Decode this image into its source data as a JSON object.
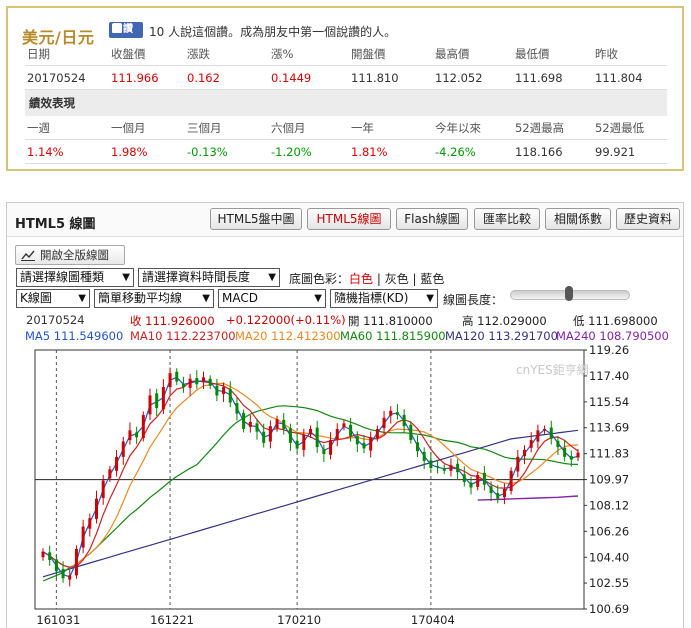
{
  "quote": {
    "title": "美元/日元",
    "like_label": "讚",
    "like_text": "10 人說這個讚。成為朋友中第一個說讚的人。",
    "headers1": [
      "日期",
      "收盤價",
      "漲跌",
      "漲%",
      "開盤價",
      "最高價",
      "最低價",
      "昨收"
    ],
    "values1": [
      "20170524",
      "111.966",
      "0.162",
      "0.1449",
      "111.810",
      "112.052",
      "111.698",
      "111.804"
    ],
    "section_title": "績效表現",
    "headers2": [
      "一週",
      "一個月",
      "三個月",
      "六個月",
      "一年",
      "今年以來",
      "52週最高",
      "52週最低"
    ],
    "values2": [
      "1.14%",
      "1.98%",
      "-0.13%",
      "-1.20%",
      "1.81%",
      "-4.26%",
      "118.166",
      "99.921"
    ]
  },
  "chart_panel": {
    "heading": "HTML5 線圖",
    "tabs": [
      "HTML5盤中圖",
      "HTML5線圖",
      "Flash線圖",
      "匯率比較",
      "相關係數",
      "歷史資料"
    ],
    "active_tab": "HTML5線圖",
    "expand_label": "開啟全版線圖",
    "selects": {
      "chart_type": "請選擇線圖種類",
      "period": "請選擇資料時間長度",
      "kline": "K線圖",
      "ma": "簡單移動平均線",
      "indicator": "MACD",
      "random": "隨機指標(KD)"
    },
    "bg_color_label": "底圖色彩：",
    "bg_options": [
      "白色",
      "灰色",
      "藍色"
    ],
    "line_length_label": "線圖長度：",
    "line_length_fraction": 0.55,
    "info": {
      "date": "20170524",
      "close": "收 111.926000",
      "change": "+0.122000(+0.11%)",
      "open": "開 111.810000",
      "high": "高 112.029000",
      "low": "低 111.698000",
      "ma5": "MA5 111.549600",
      "ma10": "MA10 112.223700",
      "ma20": "MA20 112.412300",
      "ma60": "MA60 111.815900",
      "ma120": "MA120 113.291700",
      "ma240": "MA240 108.790500"
    },
    "watermark": "cnYES鉅亨網",
    "colors": {
      "up": "#cc0000",
      "down": "#008800",
      "ma5": "#2255cc",
      "ma10": "#cc2222",
      "ma20": "#ee8822",
      "ma60": "#118811",
      "ma120": "#333388",
      "ma240": "#8822aa"
    }
  },
  "chart_data": {
    "type": "candlestick",
    "y_ticks": [
      "119.26",
      "117.40",
      "115.54",
      "113.69",
      "111.83",
      "109.97",
      "108.12",
      "106.26",
      "104.40",
      "102.55",
      "100.69"
    ],
    "ylim": [
      100.69,
      119.26
    ],
    "x_ticks": [
      "161031",
      "161221",
      "170210",
      "170404"
    ],
    "reference_line": 109.97,
    "close_path": [
      104.8,
      104.2,
      103.4,
      102.9,
      103.1,
      105.0,
      106.6,
      107.2,
      108.6,
      109.9,
      110.7,
      111.6,
      112.7,
      113.5,
      113.0,
      114.6,
      116.0,
      115.1,
      116.6,
      117.6,
      117.0,
      116.6,
      117.2,
      116.8,
      117.3,
      116.7,
      116.0,
      116.6,
      115.5,
      114.7,
      113.6,
      114.1,
      113.4,
      112.6,
      113.8,
      114.3,
      113.6,
      112.6,
      112.2,
      113.2,
      113.6,
      112.3,
      111.8,
      112.8,
      113.6,
      114.0,
      113.1,
      112.5,
      112.2,
      113.0,
      113.6,
      114.4,
      114.9,
      114.6,
      113.8,
      112.8,
      112.0,
      111.3,
      110.8,
      110.9,
      110.6,
      111.0,
      110.5,
      109.8,
      109.4,
      110.3,
      109.6,
      109.0,
      108.6,
      109.3,
      110.6,
      111.6,
      112.1,
      112.8,
      113.5,
      113.6,
      112.9,
      112.3,
      111.6,
      111.4,
      111.9
    ],
    "ma240_series": [
      108.5,
      108.55,
      108.6,
      108.65,
      108.7,
      108.79
    ]
  }
}
